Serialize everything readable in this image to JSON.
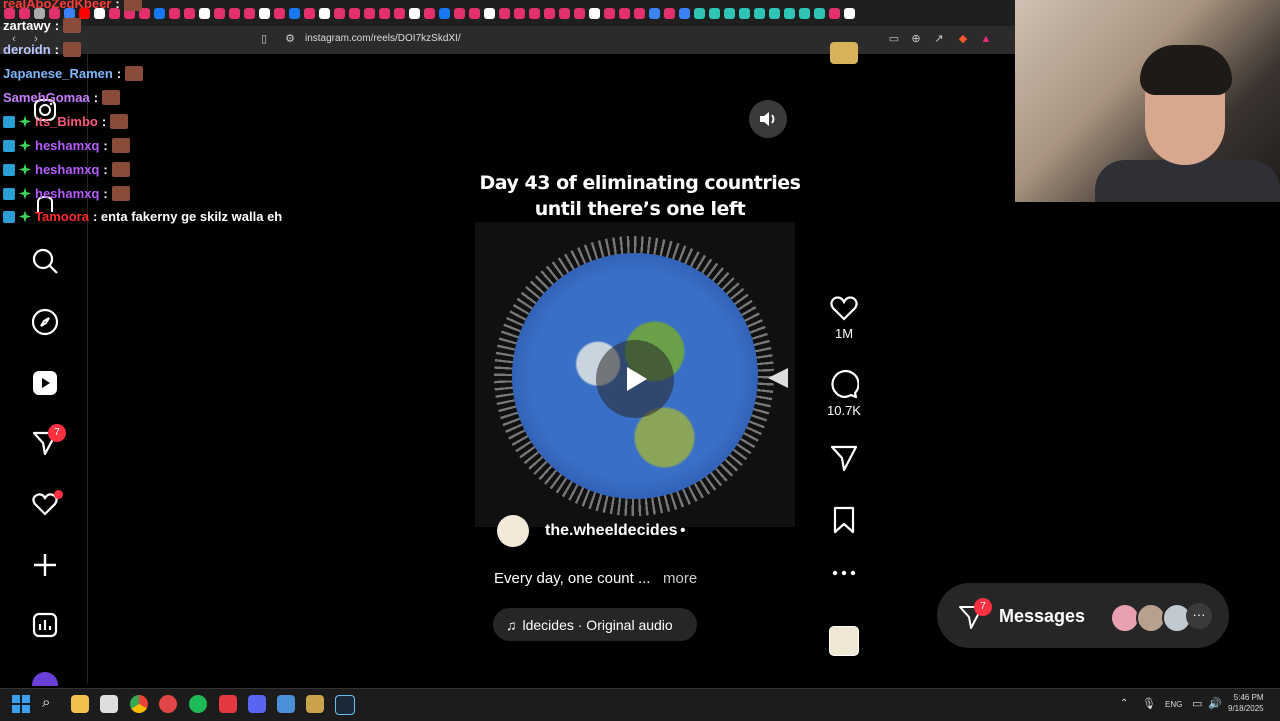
{
  "browser": {
    "url": "instagram.com/reels/DOI7kzSkdXI/"
  },
  "chat": [
    {
      "user": "realAboZedKbeer",
      "color": "#ff3b3b",
      "message": ":"
    },
    {
      "user": "zartawy",
      "color": "#ffffff",
      "message": ":"
    },
    {
      "user": "deroidn",
      "color": "#b9c6ff",
      "message": ":"
    },
    {
      "user": "Japanese_Ramen",
      "color": "#7fb8ff",
      "message": ":"
    },
    {
      "user": "SamehGomaa",
      "color": "#c880ff",
      "message": ":"
    },
    {
      "user": "its_Bimbo",
      "color": "#ff5a7a",
      "message": ":"
    },
    {
      "user": "heshamxq",
      "color": "#b65cff",
      "message": ":"
    },
    {
      "user": "heshamxq",
      "color": "#b65cff",
      "message": ":"
    },
    {
      "user": "heshamxq",
      "color": "#b65cff",
      "message": ":"
    },
    {
      "user": "Tamoora",
      "color": "#ff2b2b",
      "message": ": enta fakerny ge skilz walla eh"
    }
  ],
  "sidebar": {
    "notifications_badge": "7"
  },
  "reel": {
    "title_line1": "Day 43 of eliminating countries",
    "title_line2": "until there’s one left",
    "username": "the.wheeldecides",
    "separator": "•",
    "caption": "Every day, one count ...",
    "more_label": "more",
    "audio_label": "ldecides · Original audio"
  },
  "actions": {
    "likes": "1M",
    "comments": "10.7K"
  },
  "messages": {
    "label": "Messages",
    "badge": "7",
    "avatar_colors": [
      "#e8a0b0",
      "#b8a090",
      "#c0c8d0"
    ]
  },
  "taskbar": {
    "language": "ENG",
    "time": "5:46 PM",
    "date": "9/18/2025"
  },
  "colors": {
    "accent_red": "#ff3040",
    "panel": "#262626"
  }
}
